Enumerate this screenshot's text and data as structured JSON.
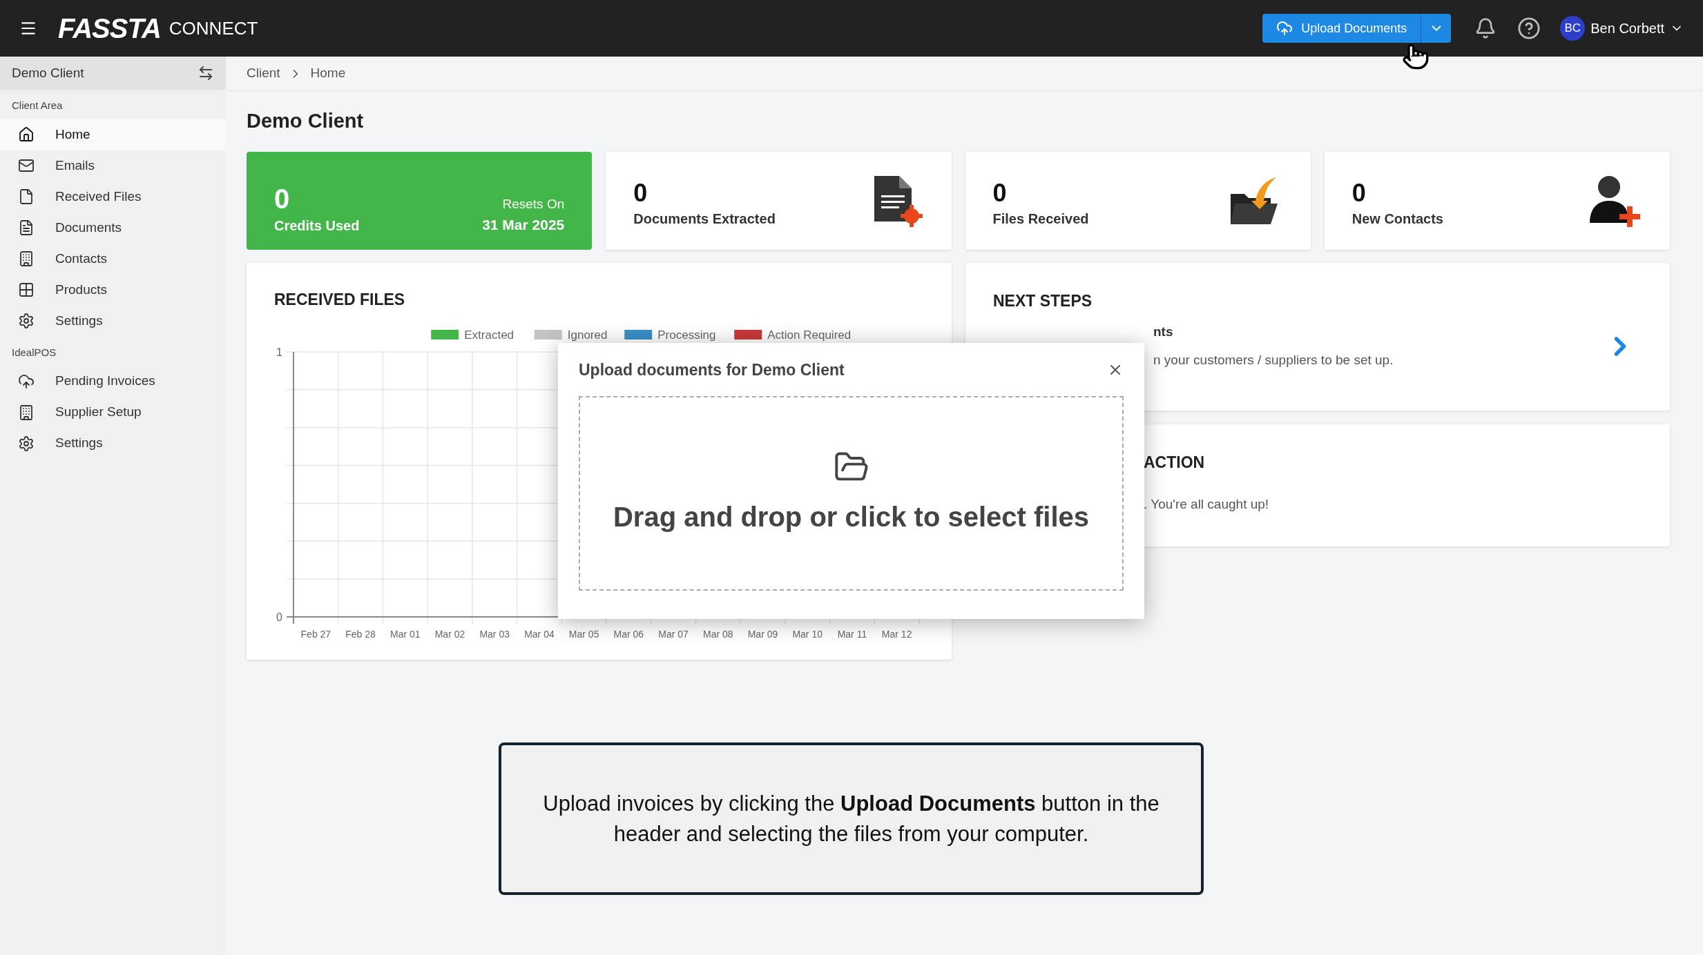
{
  "header": {
    "logo_main": "FASSTA",
    "logo_suffix": "CONNECT",
    "upload_button": "Upload Documents",
    "user": {
      "initials": "BC",
      "name": "Ben Corbett"
    }
  },
  "sidebar": {
    "client": "Demo Client",
    "sections": [
      {
        "title": "Client Area",
        "items": [
          {
            "label": "Home",
            "kind": "home",
            "selected": true
          },
          {
            "label": "Emails",
            "kind": "mail",
            "selected": false
          },
          {
            "label": "Received Files",
            "kind": "file",
            "selected": false
          },
          {
            "label": "Documents",
            "kind": "document",
            "selected": false
          },
          {
            "label": "Contacts",
            "kind": "building",
            "selected": false
          },
          {
            "label": "Products",
            "kind": "grid",
            "selected": false
          },
          {
            "label": "Settings",
            "kind": "gear",
            "selected": false
          }
        ]
      },
      {
        "title": "IdealPOS",
        "items": [
          {
            "label": "Pending Invoices",
            "kind": "cloud",
            "selected": false
          },
          {
            "label": "Supplier Setup",
            "kind": "building",
            "selected": false
          },
          {
            "label": "Settings",
            "kind": "gear",
            "selected": false
          }
        ]
      }
    ]
  },
  "breadcrumb": [
    "Client",
    "Home"
  ],
  "page_title": "Demo Client",
  "stats": [
    {
      "kind": "credits",
      "value": "0",
      "label": "Credits Used",
      "reset_label": "Resets On",
      "reset_date": "31 Mar 2025"
    },
    {
      "kind": "documents",
      "value": "0",
      "label": "Documents Extracted"
    },
    {
      "kind": "files",
      "value": "0",
      "label": "Files Received"
    },
    {
      "kind": "contacts",
      "value": "0",
      "label": "New Contacts"
    }
  ],
  "received_files": {
    "title": "RECEIVED FILES",
    "chart_data": {
      "type": "bar",
      "categories": [
        "Feb 27",
        "Feb 28",
        "Mar 01",
        "Mar 02",
        "Mar 03",
        "Mar 04",
        "Mar 05",
        "Mar 06",
        "Mar 07",
        "Mar 08",
        "Mar 09",
        "Mar 10",
        "Mar 11",
        "Mar 12"
      ],
      "series": [
        {
          "name": "Extracted",
          "color": "#43b649",
          "values": [
            0,
            0,
            0,
            0,
            0,
            0,
            0,
            0,
            0,
            0,
            0,
            0,
            0,
            0
          ]
        },
        {
          "name": "Ignored",
          "color": "#c4c4c4",
          "values": [
            0,
            0,
            0,
            0,
            0,
            0,
            0,
            0,
            0,
            0,
            0,
            0,
            0,
            0
          ]
        },
        {
          "name": "Processing",
          "color": "#3a8fc8",
          "values": [
            0,
            0,
            0,
            0,
            0,
            0,
            0,
            0,
            0,
            0,
            0,
            0,
            0,
            0
          ]
        },
        {
          "name": "Action Required",
          "color": "#c83a3a",
          "values": [
            0,
            0,
            0,
            0,
            0,
            0,
            0,
            0,
            0,
            0,
            0,
            0,
            0,
            0
          ]
        }
      ],
      "ylim": [
        0,
        1
      ],
      "yticks": [
        0,
        1
      ]
    }
  },
  "next_steps": {
    "title": "NEXT STEPS",
    "item_title": "nts",
    "item_text": "n your customers / suppliers to be set up."
  },
  "action": {
    "title": "ACTION",
    "text": ". You're all caught up!"
  },
  "upload_dialog": {
    "title": "Upload documents for Demo Client",
    "dropzone_text": "Drag and drop or click to select files"
  },
  "hint": "Upload invoices by clicking the **Upload Documents** button in the header and selecting the files from your computer."
}
